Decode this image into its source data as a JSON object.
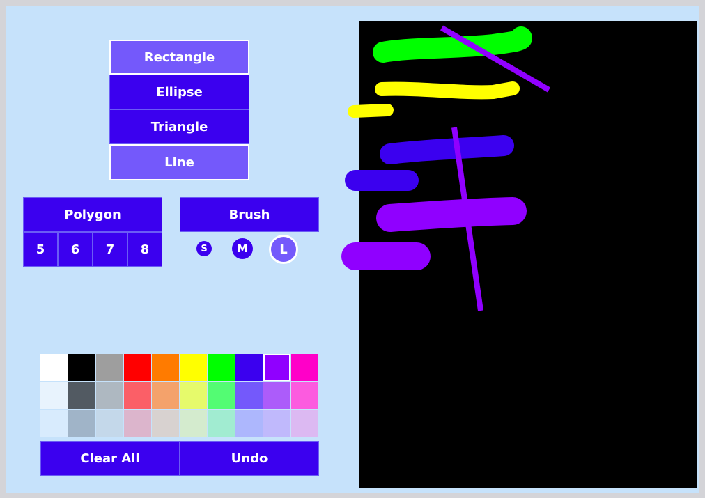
{
  "shapes": {
    "rectangle": "Rectangle",
    "ellipse": "Ellipse",
    "triangle": "Triangle",
    "line": "Line"
  },
  "polygon": {
    "label": "Polygon",
    "sides": [
      "5",
      "6",
      "7",
      "8"
    ]
  },
  "brush": {
    "label": "Brush",
    "sizes": [
      "S",
      "M",
      "L"
    ],
    "selected_size": "L"
  },
  "palette": {
    "selected": "#9000ff",
    "rows": [
      [
        "#ffffff",
        "#000000",
        "#9e9e9e",
        "#ff0000",
        "#ff7b00",
        "#ffff00",
        "#00ff00",
        "#3b00ef",
        "#9000ff",
        "#ff00c8"
      ],
      [
        "#e8f3fd",
        "#525a62",
        "#aeb8c1",
        "#fb5f67",
        "#f4a26b",
        "#e6fa6b",
        "#53fc73",
        "#7459fb",
        "#ac5cfa",
        "#fc5bdf"
      ],
      [
        "#d8ebfd",
        "#a0b4c8",
        "#c4d8ea",
        "#dcb5cc",
        "#d8d2d0",
        "#d4ebce",
        "#a1ecd1",
        "#adb7fd",
        "#c0b9fc",
        "#dcb9f2"
      ]
    ]
  },
  "actions": {
    "clear_all": "Clear All",
    "undo": "Undo"
  },
  "colors": {
    "button": "#3b00ef",
    "selected_button": "#7459fb",
    "background": "#c6e2fb",
    "canvas": "#000000"
  }
}
